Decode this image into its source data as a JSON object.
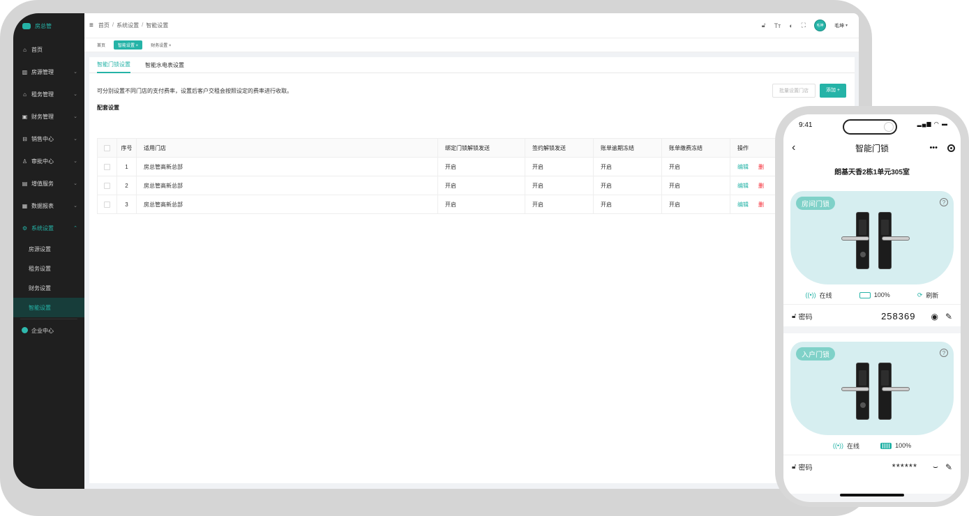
{
  "sidebar": {
    "brand": "房总管",
    "items": [
      {
        "icon": "home-icon",
        "label": "首页"
      },
      {
        "icon": "building-icon",
        "label": "房源管理"
      },
      {
        "icon": "house-icon",
        "label": "租务管理"
      },
      {
        "icon": "finance-icon",
        "label": "财务管理"
      },
      {
        "icon": "sales-icon",
        "label": "销售中心"
      },
      {
        "icon": "approval-icon",
        "label": "审批中心"
      },
      {
        "icon": "service-icon",
        "label": "增值服务"
      },
      {
        "icon": "report-icon",
        "label": "数据报表"
      },
      {
        "icon": "gear-icon",
        "label": "系统设置"
      }
    ],
    "sub_items": [
      "房源设置",
      "租务设置",
      "财务设置",
      "智能设置"
    ],
    "enterprise": "企业中心"
  },
  "topbar": {
    "breadcrumb": [
      "首页",
      "系统设置",
      "智能设置"
    ],
    "user": "毛坤",
    "avatar_text": "毛坤"
  },
  "tags": [
    {
      "label": "首页",
      "closable": false
    },
    {
      "label": "智能设置 ×",
      "closable": true
    },
    {
      "label": "财务设置 ×",
      "closable": true
    }
  ],
  "subtabs": [
    "智能门锁设置",
    "智能水电表设置"
  ],
  "description": "可分别设置不同门店的支付费率，设置后客户交租会按照设定的费率进行收取。",
  "buttons": {
    "batch": "批量设置门店",
    "add": "添加 +"
  },
  "section_title": "配套设置",
  "table": {
    "headers": [
      "序号",
      "适用门店",
      "绑定门锁解锁发送",
      "签约解锁发送",
      "账单逾期冻结",
      "账单缴费冻结",
      "操作"
    ],
    "rows": [
      {
        "idx": "1",
        "store": "房总管高新总部",
        "bind": "开启",
        "sign": "开启",
        "overdue": "开启",
        "pay": "开启",
        "edit": "编辑",
        "del": "删"
      },
      {
        "idx": "2",
        "store": "房总管高新总部",
        "bind": "开启",
        "sign": "开启",
        "overdue": "开启",
        "pay": "开启",
        "edit": "编辑",
        "del": "删"
      },
      {
        "idx": "3",
        "store": "房总管高新总部",
        "bind": "开启",
        "sign": "开启",
        "overdue": "开启",
        "pay": "开启",
        "edit": "编辑",
        "del": "删"
      }
    ]
  },
  "phone": {
    "time": "9:41",
    "title": "智能门锁",
    "room": "朗基天香2栋1单元305室",
    "card1": {
      "badge": "房间门锁",
      "online": "在线",
      "battery": "100%",
      "refresh": "刷新",
      "pwd_label": "密码",
      "pwd": "258369"
    },
    "card2": {
      "badge": "入户门锁",
      "online": "在线",
      "battery": "100%",
      "pwd_label": "密码",
      "pwd": "******"
    }
  }
}
